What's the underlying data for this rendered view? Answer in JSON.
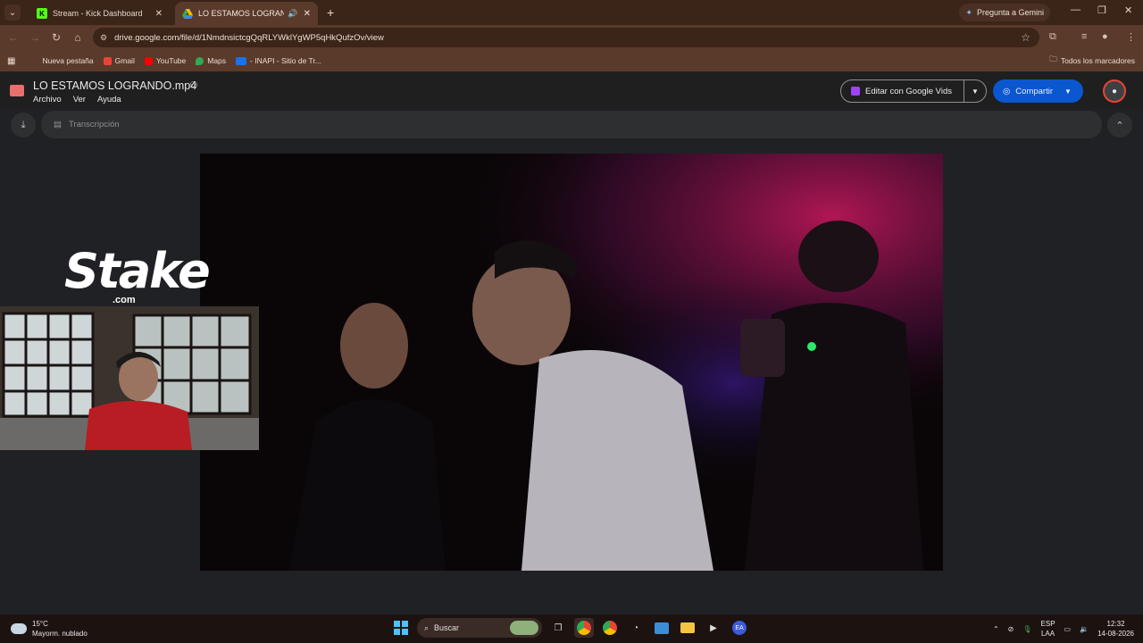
{
  "browser": {
    "tabs": [
      {
        "title": "Stream - Kick Dashboard",
        "favicon": "K",
        "favicon_color": "#53fc18",
        "active": false
      },
      {
        "title": "LO ESTAMOS LOGRANDO.m",
        "favicon": "drive-icon",
        "active": true
      }
    ],
    "gemini_label": "Pregunta a Gemini",
    "url": "drive.google.com/file/d/1NmdnsictcgQqRLYWklYgWP5qHkQufzOv/view",
    "bookmarks": [
      {
        "label": "Nueva pestaña",
        "color": "#5a3a2a"
      },
      {
        "label": "Gmail",
        "color": "#ea4335"
      },
      {
        "label": "YouTube",
        "color": "#ff0000"
      },
      {
        "label": "Maps",
        "color": "#34a853"
      },
      {
        "label": "- INAPI - Sitio de Tr...",
        "color": "#1a73e8"
      }
    ],
    "all_bookmarks": "Todos los marcadores"
  },
  "drive": {
    "filename": "LO ESTAMOS LOGRANDO.mp4",
    "menus": [
      "Archivo",
      "Ver",
      "Ayuda"
    ],
    "edit_vids_label": "Editar con Google Vids",
    "share_label": "Compartir",
    "transcription_label": "Transcripción"
  },
  "overlay": {
    "brand": "Stake",
    "brand_suffix": ".com"
  },
  "taskbar": {
    "weather_temp": "15°C",
    "weather_desc": "Mayorm. nublado",
    "search_placeholder": "Buscar",
    "lang_top": "ESP",
    "lang_bottom": "LAA",
    "time": "12:32",
    "date": "14-08-2026"
  },
  "colors": {
    "tab_strip": "#3b2418",
    "toolbar": "#5a3a2a",
    "drive_bg": "#1f1f1f",
    "share_blue": "#0b57d0"
  }
}
